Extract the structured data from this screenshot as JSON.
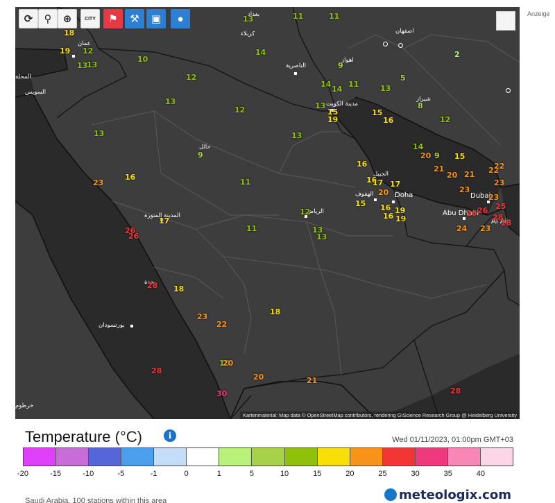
{
  "toolbar": [
    {
      "name": "refresh-button",
      "icon": "refresh-icon",
      "style": "w",
      "glyph": "⟳"
    },
    {
      "name": "location-button",
      "icon": "location-pin-icon",
      "style": "w",
      "glyph": "⚲"
    },
    {
      "name": "zoom-button",
      "icon": "zoom-icon",
      "style": "w",
      "glyph": "⊕"
    },
    {
      "name": "city-button",
      "icon": "city-icon",
      "style": "w",
      "glyph": "CITY"
    },
    {
      "name": "station-button",
      "icon": "station-icon",
      "style": "r",
      "glyph": "⚑"
    },
    {
      "name": "pressure-button",
      "icon": "pressure-icon",
      "style": "b",
      "glyph": "⚒"
    },
    {
      "name": "display-button",
      "icon": "display-icon",
      "style": "b",
      "glyph": "▣"
    },
    {
      "name": "marker-button",
      "icon": "marker-icon",
      "style": "b",
      "glyph": "●"
    }
  ],
  "share_icon": "share-icon",
  "anzeige": "Anzeige",
  "credits": "Kartenmaterial: Map data © OpenStreetMap contributors, rendering GIScience Research Group @ Heidelberg University",
  "legend": {
    "title": "Temperature",
    "unit": "(°C)",
    "info_icon": "info-icon",
    "timestamp": "Wed 01/11/2023, 01:00pm GMT+03",
    "colors": [
      "#e040fb",
      "#c86dd7",
      "#5566d8",
      "#4aa0ec",
      "#c4defa",
      "#ffffff",
      "#b8f27a",
      "#a8d14a",
      "#8fc00a",
      "#f9de0a",
      "#f79418",
      "#f23535",
      "#ee3a7c",
      "#f887b8",
      "#fcd5e6"
    ],
    "ticks": [
      "-20",
      "-15",
      "-10",
      "-5",
      "-1",
      "0",
      "1",
      "5",
      "10",
      "15",
      "20",
      "25",
      "30",
      "35",
      "40"
    ]
  },
  "brand": "meteologix.com",
  "footnote": "Saudi Arabia, 100 stations within this area",
  "places": [
    {
      "name": "بغداد"
    },
    {
      "name": "كربلاء"
    },
    {
      "name": "اصفهان"
    },
    {
      "name": "الناصرية"
    },
    {
      "name": "اهواز"
    },
    {
      "name": "شيراز"
    },
    {
      "name": "مدينة الكويت"
    },
    {
      "name": "عمان"
    },
    {
      "name": "السويس"
    },
    {
      "name": "حائل"
    },
    {
      "name": "المدينة المنورة"
    },
    {
      "name": "الرياض"
    },
    {
      "name": "الهفوف"
    },
    {
      "name": "الجبيل"
    },
    {
      "name": "Doha"
    },
    {
      "name": "Dubai"
    },
    {
      "name": "Abu Dhabi"
    },
    {
      "name": "Al Ain"
    },
    {
      "name": "جدة"
    },
    {
      "name": "بورتسودان"
    },
    {
      "name": "خرطوم"
    },
    {
      "name": "المحلة"
    }
  ],
  "stations": [
    {
      "t": 18
    },
    {
      "t": 19
    },
    {
      "t": 12
    },
    {
      "t": 13
    },
    {
      "t": 10
    },
    {
      "t": 12
    },
    {
      "t": 13
    },
    {
      "t": 12
    },
    {
      "t": 14
    },
    {
      "t": 11
    },
    {
      "t": 13
    },
    {
      "t": 11
    },
    {
      "t": 2
    },
    {
      "t": 9
    },
    {
      "t": 14
    },
    {
      "t": 14
    },
    {
      "t": 11
    },
    {
      "t": 13
    },
    {
      "t": 5
    },
    {
      "t": 8
    },
    {
      "t": 12
    },
    {
      "t": 13
    },
    {
      "t": 15
    },
    {
      "t": 19
    },
    {
      "t": 15
    },
    {
      "t": 16
    },
    {
      "t": 13
    },
    {
      "t": 13
    },
    {
      "t": 9
    },
    {
      "t": 14
    },
    {
      "t": 20
    },
    {
      "t": 9
    },
    {
      "t": 15
    },
    {
      "t": 21
    },
    {
      "t": 20
    },
    {
      "t": 21
    },
    {
      "t": 22
    },
    {
      "t": 22
    },
    {
      "t": 23
    },
    {
      "t": 23
    },
    {
      "t": 23
    },
    {
      "t": 25
    },
    {
      "t": 28
    },
    {
      "t": 26
    },
    {
      "t": 26
    },
    {
      "t": 24
    },
    {
      "t": 23
    },
    {
      "t": 28
    },
    {
      "t": 16
    },
    {
      "t": 16
    },
    {
      "t": 17
    },
    {
      "t": 20
    },
    {
      "t": 17
    },
    {
      "t": 15
    },
    {
      "t": 16
    },
    {
      "t": 19
    },
    {
      "t": 19
    },
    {
      "t": 16
    },
    {
      "t": 23
    },
    {
      "t": 16
    },
    {
      "t": 11
    },
    {
      "t": 17
    },
    {
      "t": 11
    },
    {
      "t": 12
    },
    {
      "t": 13
    },
    {
      "t": 26
    },
    {
      "t": 26
    },
    {
      "t": 28
    },
    {
      "t": 18
    },
    {
      "t": 23
    },
    {
      "t": 22
    },
    {
      "t": 18
    },
    {
      "t": 10
    },
    {
      "t": 20
    },
    {
      "t": 20
    },
    {
      "t": 21
    },
    {
      "t": 28
    },
    {
      "t": 30
    },
    {
      "t": 28
    },
    {
      "t": 13
    },
    {
      "t": 13
    }
  ]
}
